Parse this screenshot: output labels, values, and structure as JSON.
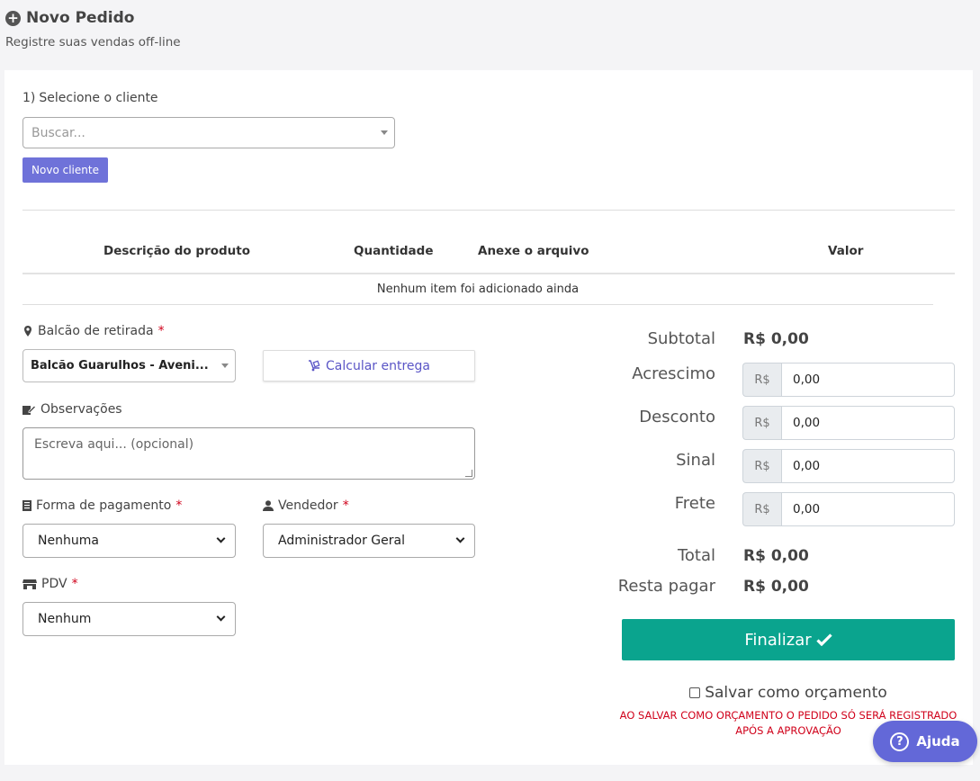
{
  "header": {
    "title": "Novo Pedido",
    "subtitle": "Registre suas vendas off-line"
  },
  "client": {
    "step_number": "1)",
    "step_label": "Selecione o cliente",
    "search_placeholder": "Buscar...",
    "new_client_label": "Novo cliente"
  },
  "table": {
    "headers": [
      "Descrição do produto",
      "Quantidade",
      "Anexe o arquivo",
      "Valor"
    ],
    "empty_message": "Nenhum item foi adicionado ainda"
  },
  "form": {
    "pickup_label": "Balcão de retirada",
    "pickup_value": "Balcão Guarulhos - Aveni...",
    "calc_delivery_label": "Calcular entrega",
    "notes_label": "Observações",
    "notes_placeholder": "Escreva aqui... (opcional)",
    "payment_label": "Forma de pagamento",
    "payment_value": "Nenhuma",
    "seller_label": "Vendedor",
    "seller_value": "Administrador Geral",
    "pdv_label": "PDV",
    "pdv_value": "Nenhum",
    "required_mark": "*"
  },
  "summary": {
    "subtotal_label": "Subtotal",
    "subtotal_value": "R$ 0,00",
    "currency": "R$",
    "acrescimo_label": "Acrescimo",
    "acrescimo_value": "0,00",
    "desconto_label": "Desconto",
    "desconto_value": "0,00",
    "sinal_label": "Sinal",
    "sinal_value": "0,00",
    "frete_label": "Frete",
    "frete_value": "0,00",
    "total_label": "Total",
    "total_value": "R$ 0,00",
    "resta_label": "Resta pagar",
    "resta_value": "R$ 0,00",
    "finalize_label": "Finalizar",
    "save_quote_label": "Salvar como orçamento",
    "warning_line1": "AO SALVAR COMO ORÇAMENTO O PEDIDO SÓ SERÁ REGISTRADO",
    "warning_line2": "APÓS A APROVAÇÃO"
  },
  "help": {
    "label": "Ajuda"
  },
  "colors": {
    "accent_purple": "#6f72d9",
    "finalize_green": "#0aa48e",
    "required_red": "#d0021b"
  }
}
